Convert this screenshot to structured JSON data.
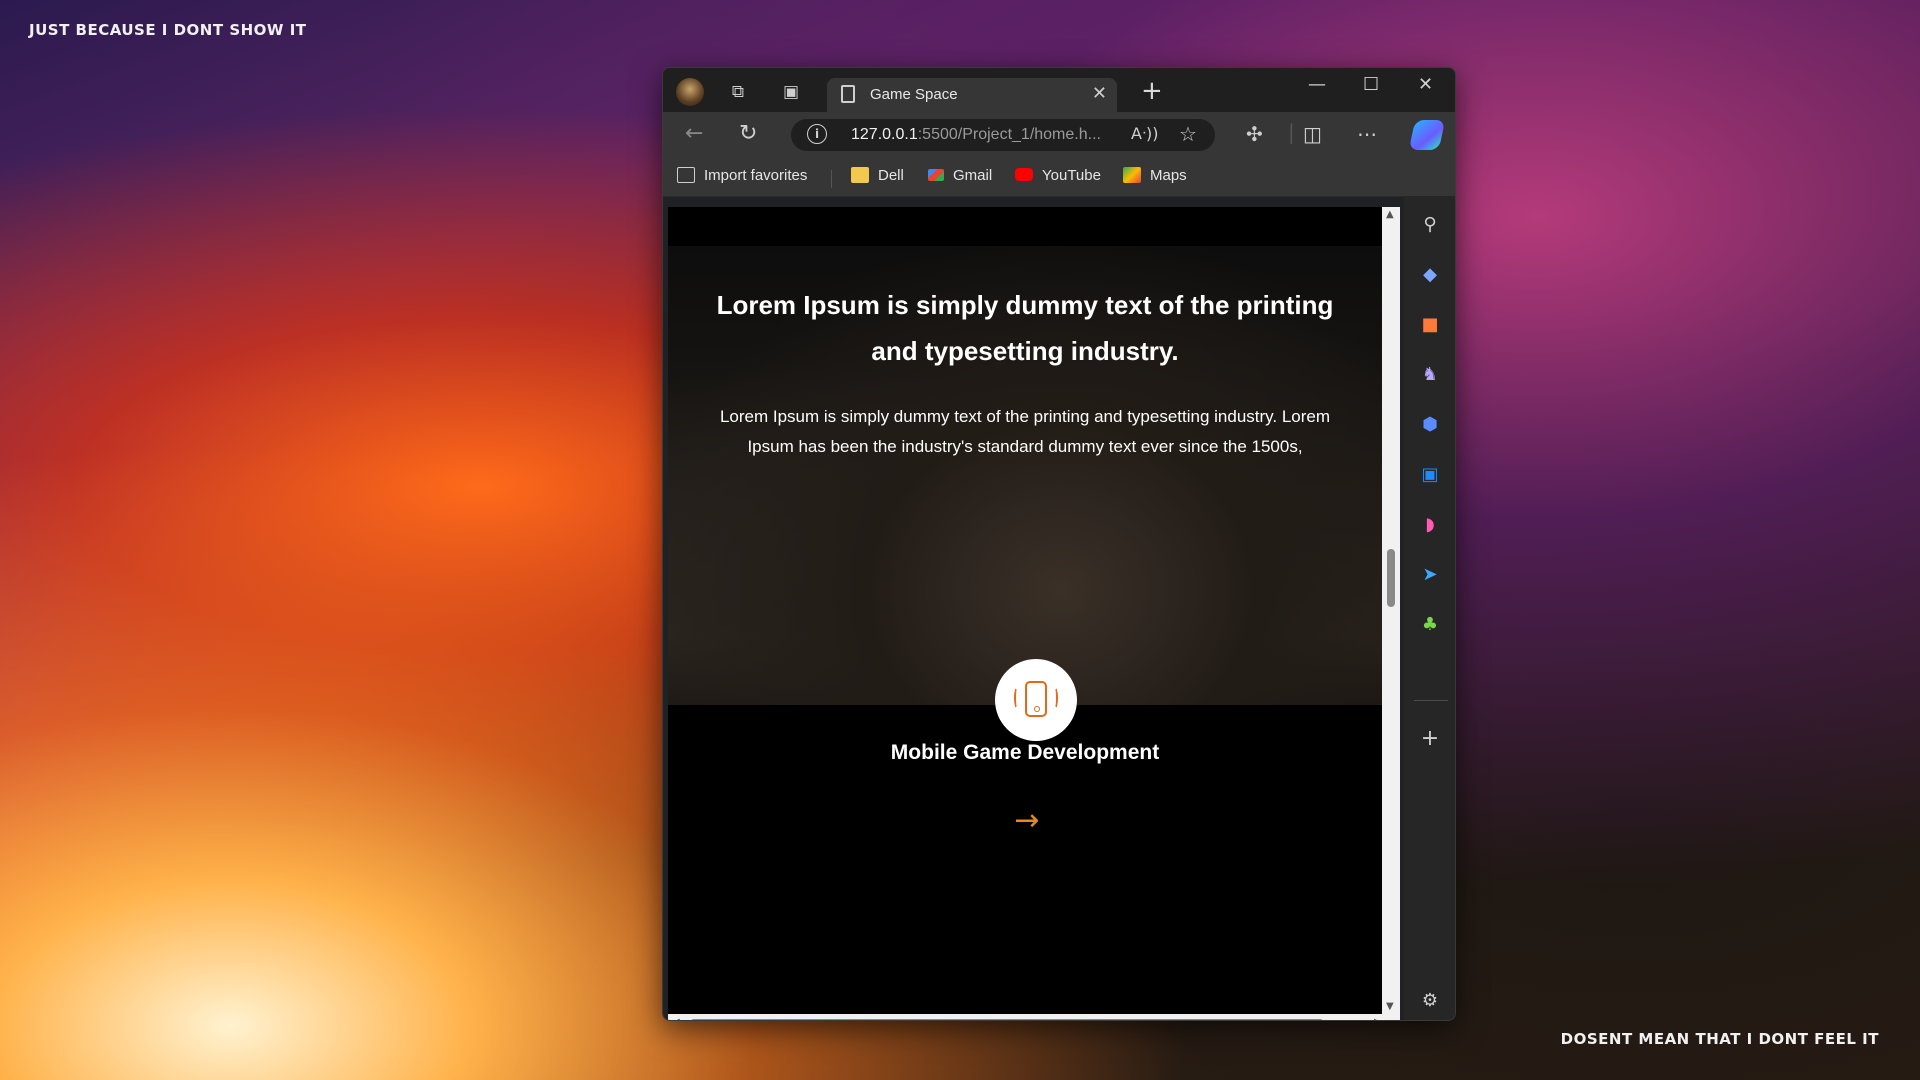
{
  "wallpaper": {
    "top_text": "JUST BECAUSE I DONT SHOW IT",
    "bottom_text": "DOSENT MEAN THAT I DONT FEEL IT"
  },
  "browser": {
    "tab": {
      "title": "Game Space",
      "close_glyph": "✕"
    },
    "new_tab_glyph": "+",
    "window_controls": {
      "minimize": "—",
      "maximize": "☐",
      "close": "✕"
    },
    "address": {
      "host": "127.0.0.1",
      "path": ":5500/Project_1/home.h...",
      "read_aloud": "A)"
    },
    "favorites": [
      {
        "label": "Import favorites",
        "icon": "import-icon",
        "color": "#cfcfcf"
      },
      {
        "label": "Dell",
        "icon": "folder-icon",
        "color": "#f2c94c"
      },
      {
        "label": "Gmail",
        "icon": "gmail-icon",
        "color": "#ea4335"
      },
      {
        "label": "YouTube",
        "icon": "youtube-icon",
        "color": "#ff0000"
      },
      {
        "label": "Maps",
        "icon": "maps-icon",
        "color": "#34a853"
      }
    ],
    "sidebar_icons": [
      "search-icon",
      "tag-icon",
      "briefcase-icon",
      "chess-icon",
      "copilot-icon",
      "outlook-icon",
      "designer-icon",
      "telegram-icon",
      "tree-icon",
      "add-icon",
      "settings-icon"
    ]
  },
  "page": {
    "hero_title": "Lorem Ipsum is simply dummy text of the printing and typesetting industry.",
    "hero_text": "Lorem Ipsum is simply dummy text of the printing and typesetting industry. Lorem Ipsum has been the industry's standard dummy text ever since the 1500s,",
    "service_title": "Mobile Game Development",
    "service_arrow": "→",
    "accent_color": "#e88a1a"
  }
}
